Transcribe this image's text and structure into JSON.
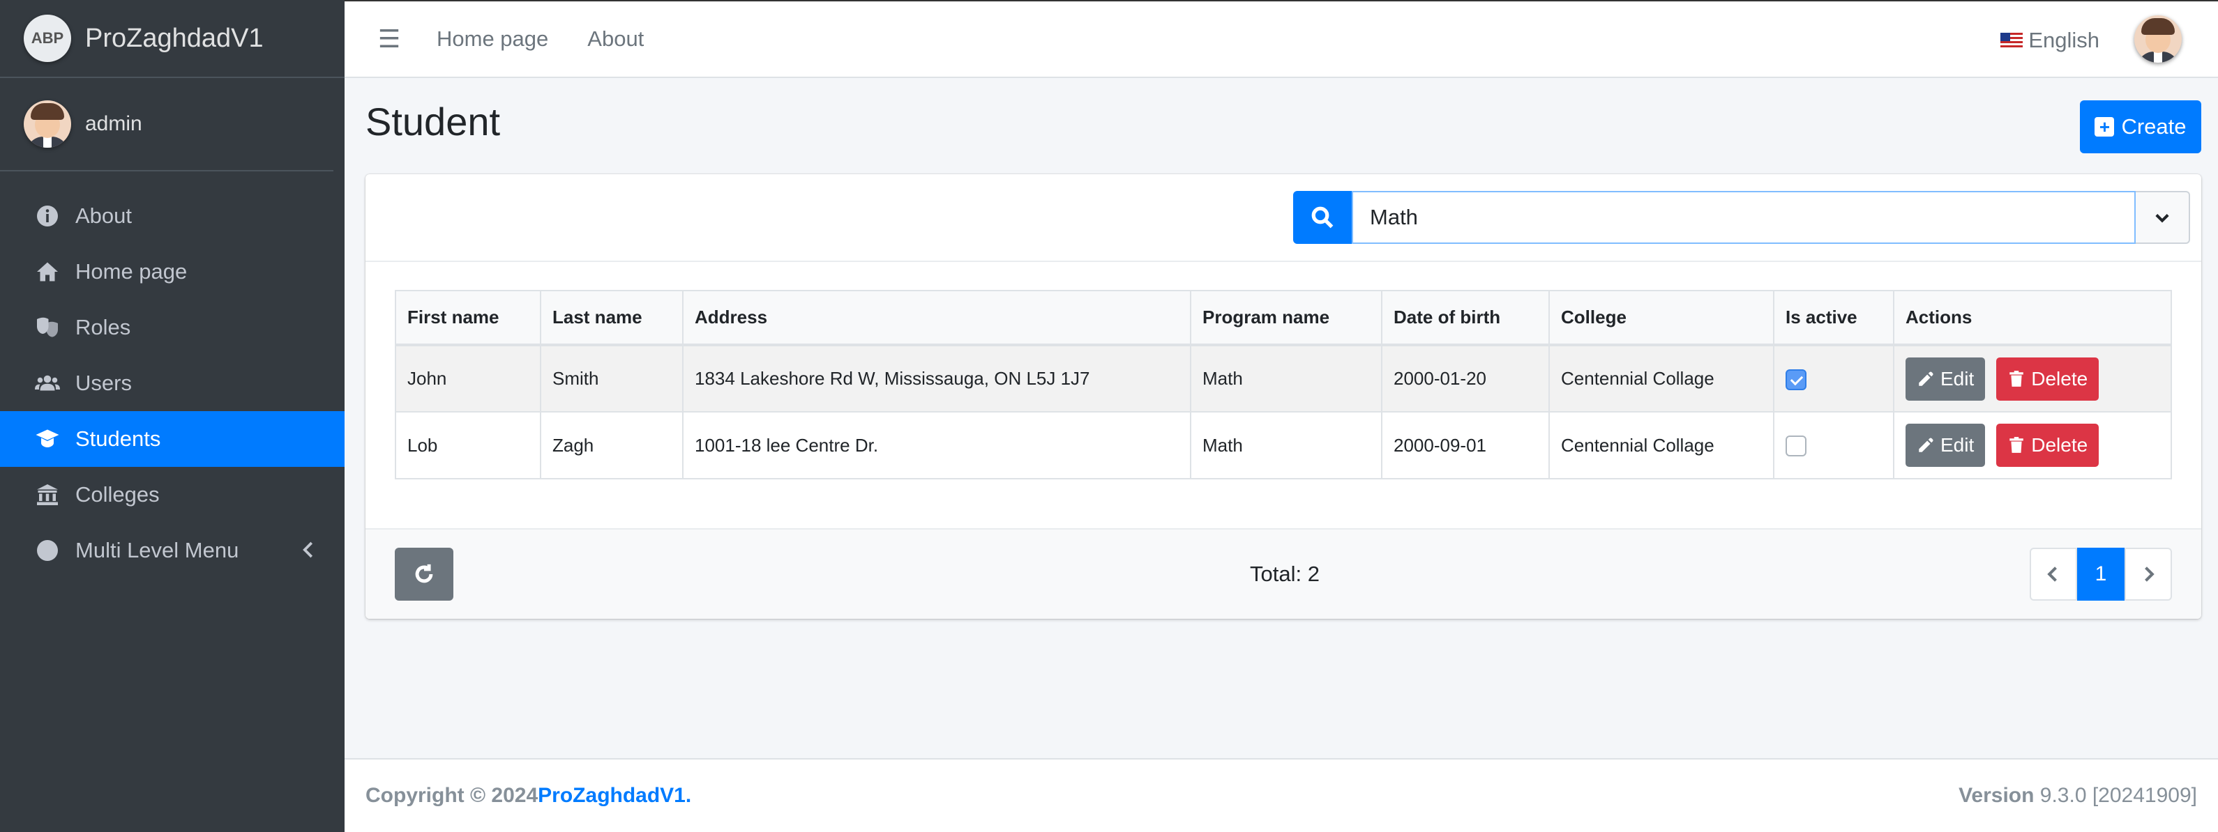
{
  "brand": {
    "logo_text": "ABP",
    "name": "ProZaghdadV1"
  },
  "user": {
    "name": "admin"
  },
  "sidebar": {
    "items": [
      {
        "label": "About",
        "icon": "info-circle-icon"
      },
      {
        "label": "Home page",
        "icon": "home-icon"
      },
      {
        "label": "Roles",
        "icon": "theater-masks-icon"
      },
      {
        "label": "Users",
        "icon": "users-icon"
      },
      {
        "label": "Students",
        "icon": "graduation-cap-icon",
        "active": true
      },
      {
        "label": "Colleges",
        "icon": "university-icon"
      },
      {
        "label": "Multi Level Menu",
        "icon": "circle-icon"
      }
    ]
  },
  "topbar": {
    "links": [
      "Home page",
      "About"
    ],
    "language": "English"
  },
  "page": {
    "title": "Student",
    "create_label": "Create"
  },
  "search": {
    "value": "Math"
  },
  "table": {
    "headers": [
      "First name",
      "Last name",
      "Address",
      "Program name",
      "Date of birth",
      "College",
      "Is active",
      "Actions"
    ],
    "rows": [
      {
        "first": "John",
        "last": "Smith",
        "address": "1834 Lakeshore Rd W, Mississauga, ON L5J 1J7",
        "program": "Math",
        "dob": "2000-01-20",
        "college": "Centennial Collage",
        "active": true
      },
      {
        "first": "Lob",
        "last": "Zagh",
        "address": "1001-18 lee Centre Dr.",
        "program": "Math",
        "dob": "2000-09-01",
        "college": "Centennial Collage",
        "active": false
      }
    ],
    "edit_label": "Edit",
    "delete_label": "Delete"
  },
  "pagination": {
    "total": "Total: 2",
    "current_page": "1"
  },
  "footer": {
    "copyright": "Copyright © 2024 ",
    "brand": "ProZaghdadV1",
    "dot": ".",
    "version_label": "Version",
    "version_value": " 9.3.0 [20241909]"
  },
  "colors": {
    "primary": "#007bff",
    "sidebar": "#343a40",
    "danger": "#dc3545",
    "secondary": "#6c757d"
  }
}
